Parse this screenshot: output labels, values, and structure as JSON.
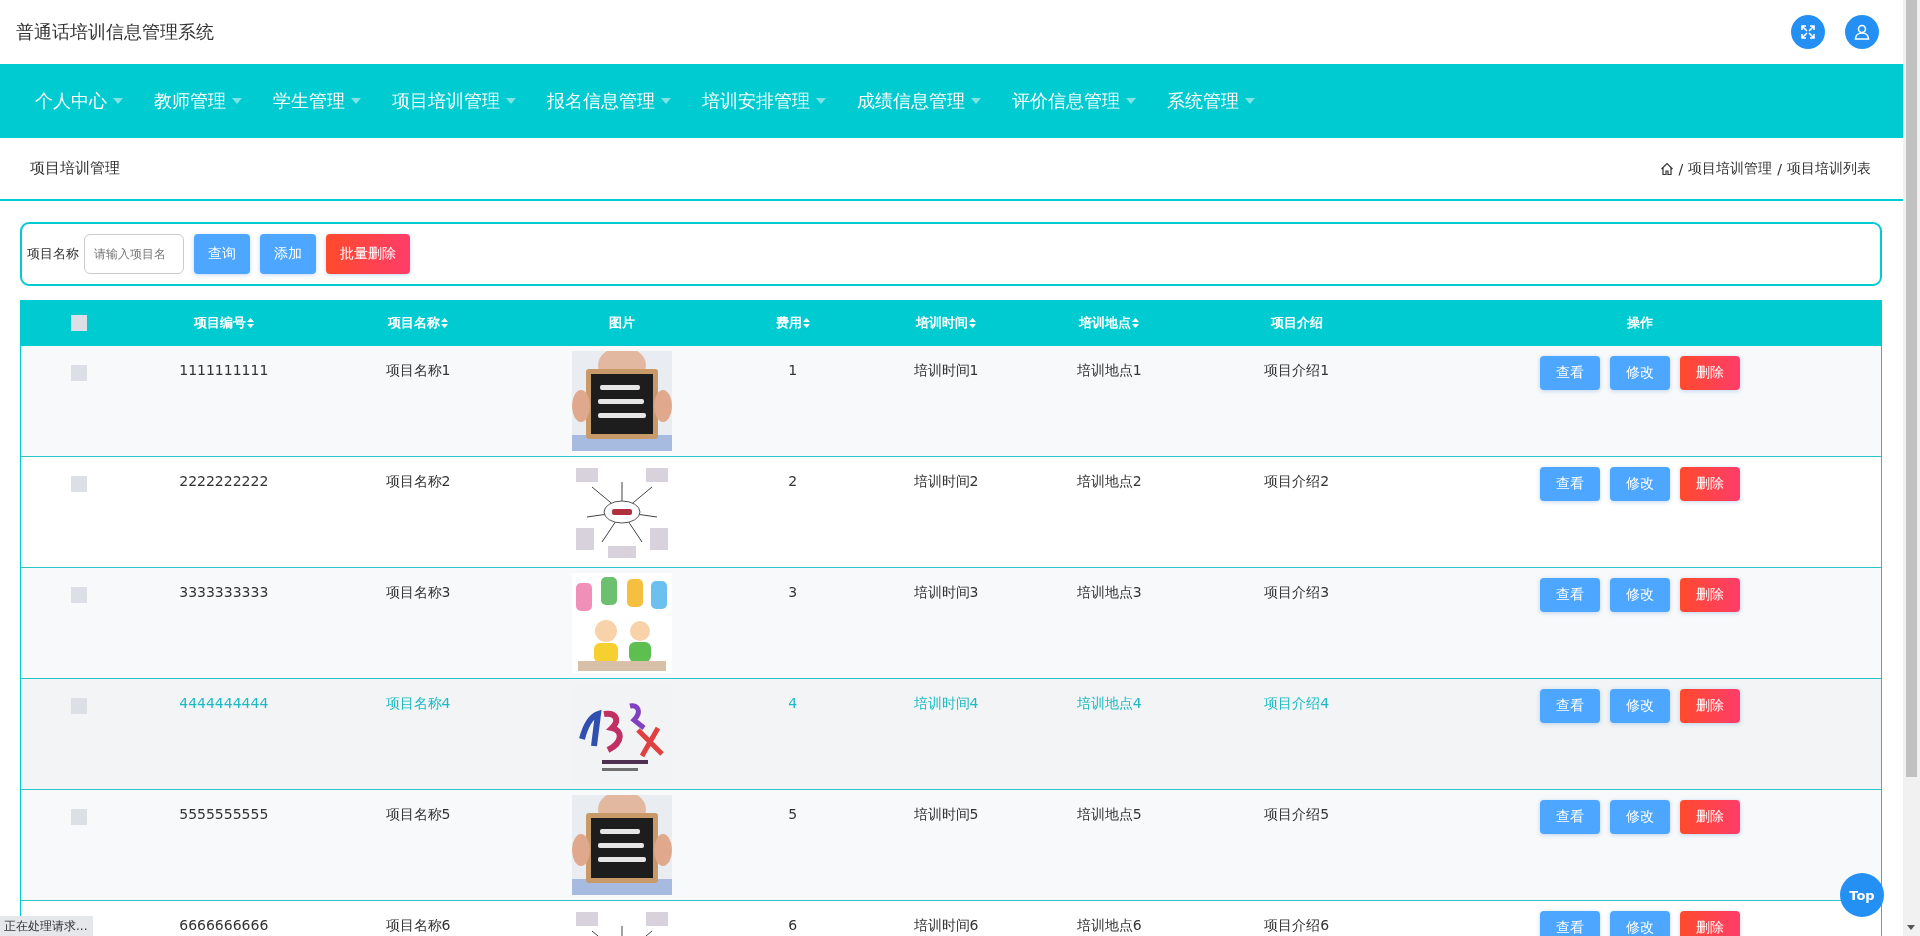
{
  "header": {
    "title": "普通话培训信息管理系统"
  },
  "nav": [
    "个人中心",
    "教师管理",
    "学生管理",
    "项目培训管理",
    "报名信息管理",
    "培训安排管理",
    "成绩信息管理",
    "评价信息管理",
    "系统管理"
  ],
  "page_title": "项目培训管理",
  "breadcrumb": [
    {
      "separator": "/",
      "label": "项目培训管理"
    },
    {
      "separator": "/",
      "label": "项目培训列表"
    }
  ],
  "search": {
    "label": "项目名称",
    "placeholder": "请输入项目名",
    "buttons": [
      {
        "label": "查询",
        "kind": "primary"
      },
      {
        "label": "添加",
        "kind": "primary"
      },
      {
        "label": "批量删除",
        "kind": "danger"
      }
    ]
  },
  "table": {
    "select_all": {
      "checked": false
    },
    "columns": [
      {
        "label": "项目编号",
        "sortable": true
      },
      {
        "label": "项目名称",
        "sortable": true
      },
      {
        "label": "图片",
        "sortable": false
      },
      {
        "label": "费用",
        "sortable": true
      },
      {
        "label": "培训时间",
        "sortable": true
      },
      {
        "label": "培训地点",
        "sortable": true
      },
      {
        "label": "项目介绍",
        "sortable": false
      },
      {
        "label": "操作",
        "sortable": false
      }
    ],
    "rows": [
      {
        "checked": false,
        "hovered": false,
        "cells": [
          "1111111111",
          "项目名称1",
          {
            "kind": "picture"
          },
          "1",
          "培训时间1",
          "培训地点1",
          "项目介绍1"
        ],
        "actions": [
          {
            "label": "查看",
            "kind": "primary"
          },
          {
            "label": "修改",
            "kind": "primary"
          },
          {
            "label": "删除",
            "kind": "danger"
          }
        ]
      },
      {
        "checked": false,
        "hovered": false,
        "cells": [
          "2222222222",
          "项目名称2",
          {
            "kind": "picture"
          },
          "2",
          "培训时间2",
          "培训地点2",
          "项目介绍2"
        ],
        "actions": [
          {
            "label": "查看",
            "kind": "primary"
          },
          {
            "label": "修改",
            "kind": "primary"
          },
          {
            "label": "删除",
            "kind": "danger"
          }
        ]
      },
      {
        "checked": false,
        "hovered": false,
        "cells": [
          "3333333333",
          "项目名称3",
          {
            "kind": "picture"
          },
          "3",
          "培训时间3",
          "培训地点3",
          "项目介绍3"
        ],
        "actions": [
          {
            "label": "查看",
            "kind": "primary"
          },
          {
            "label": "修改",
            "kind": "primary"
          },
          {
            "label": "删除",
            "kind": "danger"
          }
        ]
      },
      {
        "checked": false,
        "hovered": true,
        "cells": [
          "4444444444",
          "项目名称4",
          {
            "kind": "picture"
          },
          "4",
          "培训时间4",
          "培训地点4",
          "项目介绍4"
        ],
        "actions": [
          {
            "label": "查看",
            "kind": "primary"
          },
          {
            "label": "修改",
            "kind": "primary"
          },
          {
            "label": "删除",
            "kind": "danger"
          }
        ]
      },
      {
        "checked": false,
        "hovered": false,
        "cells": [
          "5555555555",
          "项目名称5",
          {
            "kind": "picture"
          },
          "5",
          "培训时间5",
          "培训地点5",
          "项目介绍5"
        ],
        "actions": [
          {
            "label": "查看",
            "kind": "primary"
          },
          {
            "label": "修改",
            "kind": "primary"
          },
          {
            "label": "删除",
            "kind": "danger"
          }
        ]
      },
      {
        "hovered": false,
        "cells": [
          "6666666666",
          "项目名称6",
          {
            "kind": "picture"
          },
          "6",
          "培训时间6",
          "培训地点6",
          "项目介绍6"
        ],
        "actions": [
          {
            "label": "查看",
            "kind": "primary"
          },
          {
            "label": "修改",
            "kind": "primary"
          },
          {
            "label": "删除",
            "kind": "danger"
          }
        ]
      }
    ]
  },
  "status_bar": "正在处理请求...",
  "back_to_top": "Top"
}
